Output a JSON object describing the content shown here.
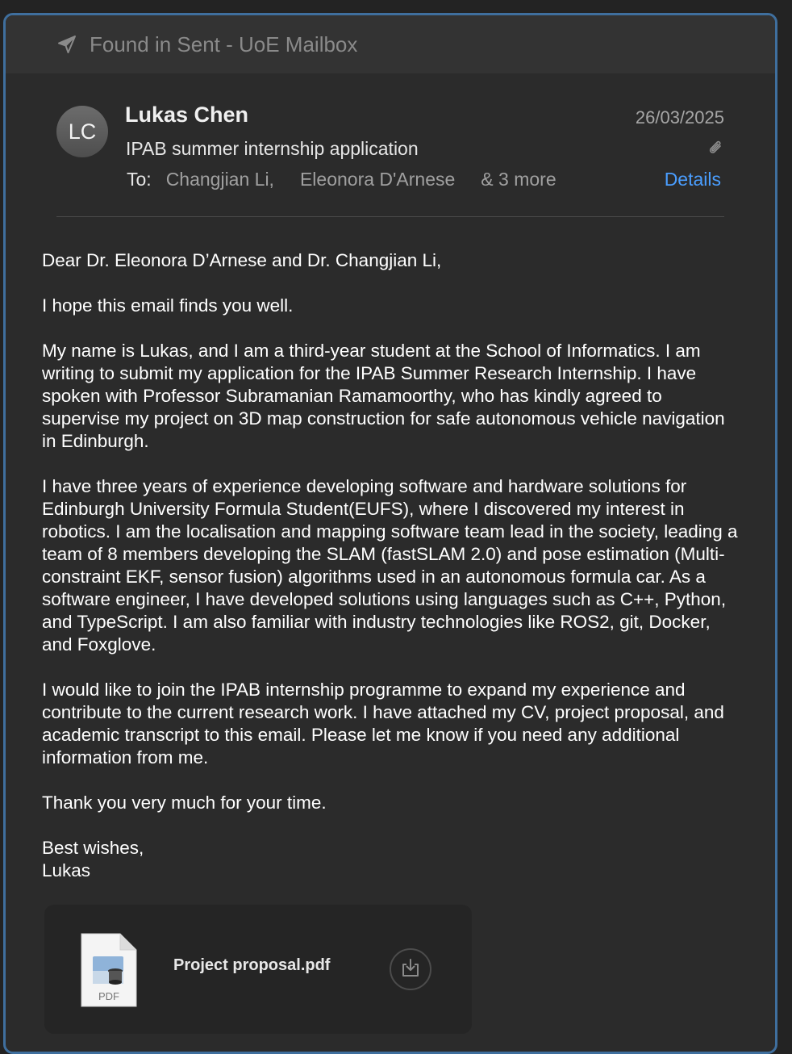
{
  "banner": {
    "icon": "send-arrow-icon",
    "text": "Found in Sent - UoE Mailbox"
  },
  "message": {
    "avatar_initials": "LC",
    "sender": "Lukas Chen",
    "subject": "IPAB summer internship application",
    "date": "26/03/2025",
    "to_label": "To:",
    "recipients": [
      "Changjian Li,",
      "Eleonora D'Arnese"
    ],
    "more_recipients": "& 3 more",
    "details_label": "Details",
    "has_attachment_icon": "paperclip-icon"
  },
  "body": {
    "greeting": "Dear Dr. Eleonora D’Arnese and Dr. Changjian Li,",
    "p1": "I hope this email finds you well.",
    "p2": "My name is Lukas, and I am a third-year student at the School of Informatics. I am writing to submit my application for the IPAB Summer Research Internship. I have spoken with Professor Subramanian Ramamoorthy, who has kindly agreed to supervise my project on 3D map construction for safe autonomous vehicle navigation in Edinburgh.",
    "p3": "I have three years of experience developing software and hardware solutions for Edinburgh University Formula Student(EUFS), where I discovered my interest in robotics. I am the localisation and mapping software team lead in the society, leading a team of 8 members developing the SLAM (fastSLAM 2.0) and pose estimation (Multi-constraint EKF, sensor fusion) algorithms used in an autonomous formula car. As a software engineer, I have developed solutions using languages such as C++, Python, and TypeScript. I am also familiar with industry technologies like ROS2, git, Docker, and Foxglove.",
    "p4": "I would like to join the IPAB internship programme to expand my experience and contribute to the current research work. I have attached my CV, project proposal, and academic transcript to this email. Please let me know if you need any additional information from me.",
    "p5": "Thank you very much for your time.",
    "closing": "Best wishes,",
    "signature": "Lukas"
  },
  "attachment": {
    "file_name": "Project proposal.pdf",
    "file_type_label": "PDF",
    "download_icon": "download-icon"
  },
  "colors": {
    "accent": "#4a9eff",
    "window_border": "#3f6f9e",
    "background": "#2b2b2b"
  }
}
